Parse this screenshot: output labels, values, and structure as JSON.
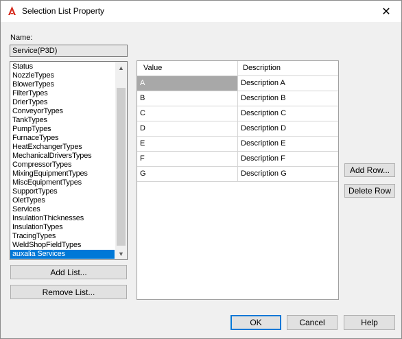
{
  "window": {
    "title": "Selection List Property",
    "close_glyph": "✕",
    "app_icon": "autocad-a-icon",
    "accent_color": "#0078d7"
  },
  "name_section": {
    "label": "Name:",
    "value": "Service(P3D)"
  },
  "lists": {
    "items": [
      "Status",
      "NozzleTypes",
      "BlowerTypes",
      "FilterTypes",
      "DrierTypes",
      "ConveyorTypes",
      "TankTypes",
      "PumpTypes",
      "FurnaceTypes",
      "HeatExchangerTypes",
      "MechanicalDriversTypes",
      "CompressorTypes",
      "MixingEquipmentTypes",
      "MiscEquipmentTypes",
      "SupportTypes",
      "OletTypes",
      "Services",
      "InsulationThicknesses",
      "InsulationTypes",
      "TracingTypes",
      "WeldShopFieldTypes",
      "auxalia Services"
    ],
    "selected_index": 21,
    "scroll_up_glyph": "▲",
    "scroll_down_glyph": "▼"
  },
  "list_buttons": {
    "add": "Add List...",
    "remove": "Remove List..."
  },
  "grid": {
    "headers": {
      "value": "Value",
      "description": "Description"
    },
    "rows": [
      {
        "value": "A",
        "description": "Description A"
      },
      {
        "value": "B",
        "description": "Description B"
      },
      {
        "value": "C",
        "description": "Description C"
      },
      {
        "value": "D",
        "description": "Description D"
      },
      {
        "value": "E",
        "description": "Description E"
      },
      {
        "value": "F",
        "description": "Description F"
      },
      {
        "value": "G",
        "description": "Description G"
      }
    ],
    "selected_row": 0
  },
  "row_buttons": {
    "add": "Add Row...",
    "delete": "Delete Row"
  },
  "footer": {
    "ok": "OK",
    "cancel": "Cancel",
    "help": "Help"
  }
}
